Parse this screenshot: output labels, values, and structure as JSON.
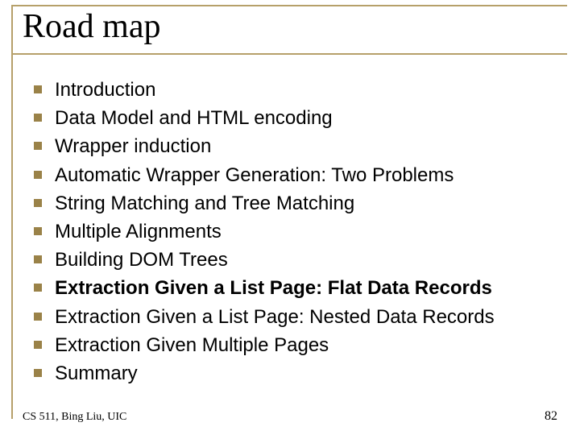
{
  "title": "Road map",
  "items": [
    {
      "text": "Introduction",
      "bold": false
    },
    {
      "text": "Data Model and HTML encoding",
      "bold": false
    },
    {
      "text": "Wrapper induction",
      "bold": false
    },
    {
      "text": "Automatic Wrapper Generation: Two Problems",
      "bold": false
    },
    {
      "text": "String Matching and Tree Matching",
      "bold": false
    },
    {
      "text": "Multiple Alignments",
      "bold": false
    },
    {
      "text": "Building DOM Trees",
      "bold": false
    },
    {
      "text": "Extraction Given a List Page: Flat Data Records",
      "bold": true
    },
    {
      "text": "Extraction Given a List Page: Nested Data Records",
      "bold": false
    },
    {
      "text": "Extraction Given Multiple Pages",
      "bold": false
    },
    {
      "text": "Summary",
      "bold": false
    }
  ],
  "footer_left": "CS 511, Bing Liu, UIC",
  "footer_right": "82"
}
